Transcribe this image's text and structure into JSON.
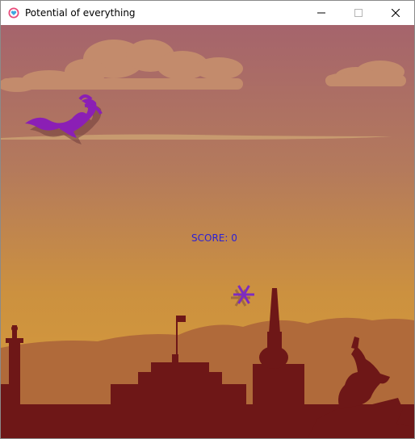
{
  "window": {
    "title": "Potential of everything",
    "controls": [
      "minimize-icon",
      "maximize-icon",
      "close-icon"
    ]
  },
  "game": {
    "score_text": "SCORE: 0",
    "score": 0,
    "sprites": [
      "dragon",
      "snowflake"
    ],
    "background": "sunset city skyline with clouds"
  },
  "colors": {
    "sky_top": "#a8676a",
    "sky_bottom": "#d39a3e",
    "cloud": "#c58d6a",
    "hills": "#b06a3a",
    "silhouette": "#6e1717",
    "dragon": "#8b1fb5",
    "score_text": "#2a1fd6"
  }
}
